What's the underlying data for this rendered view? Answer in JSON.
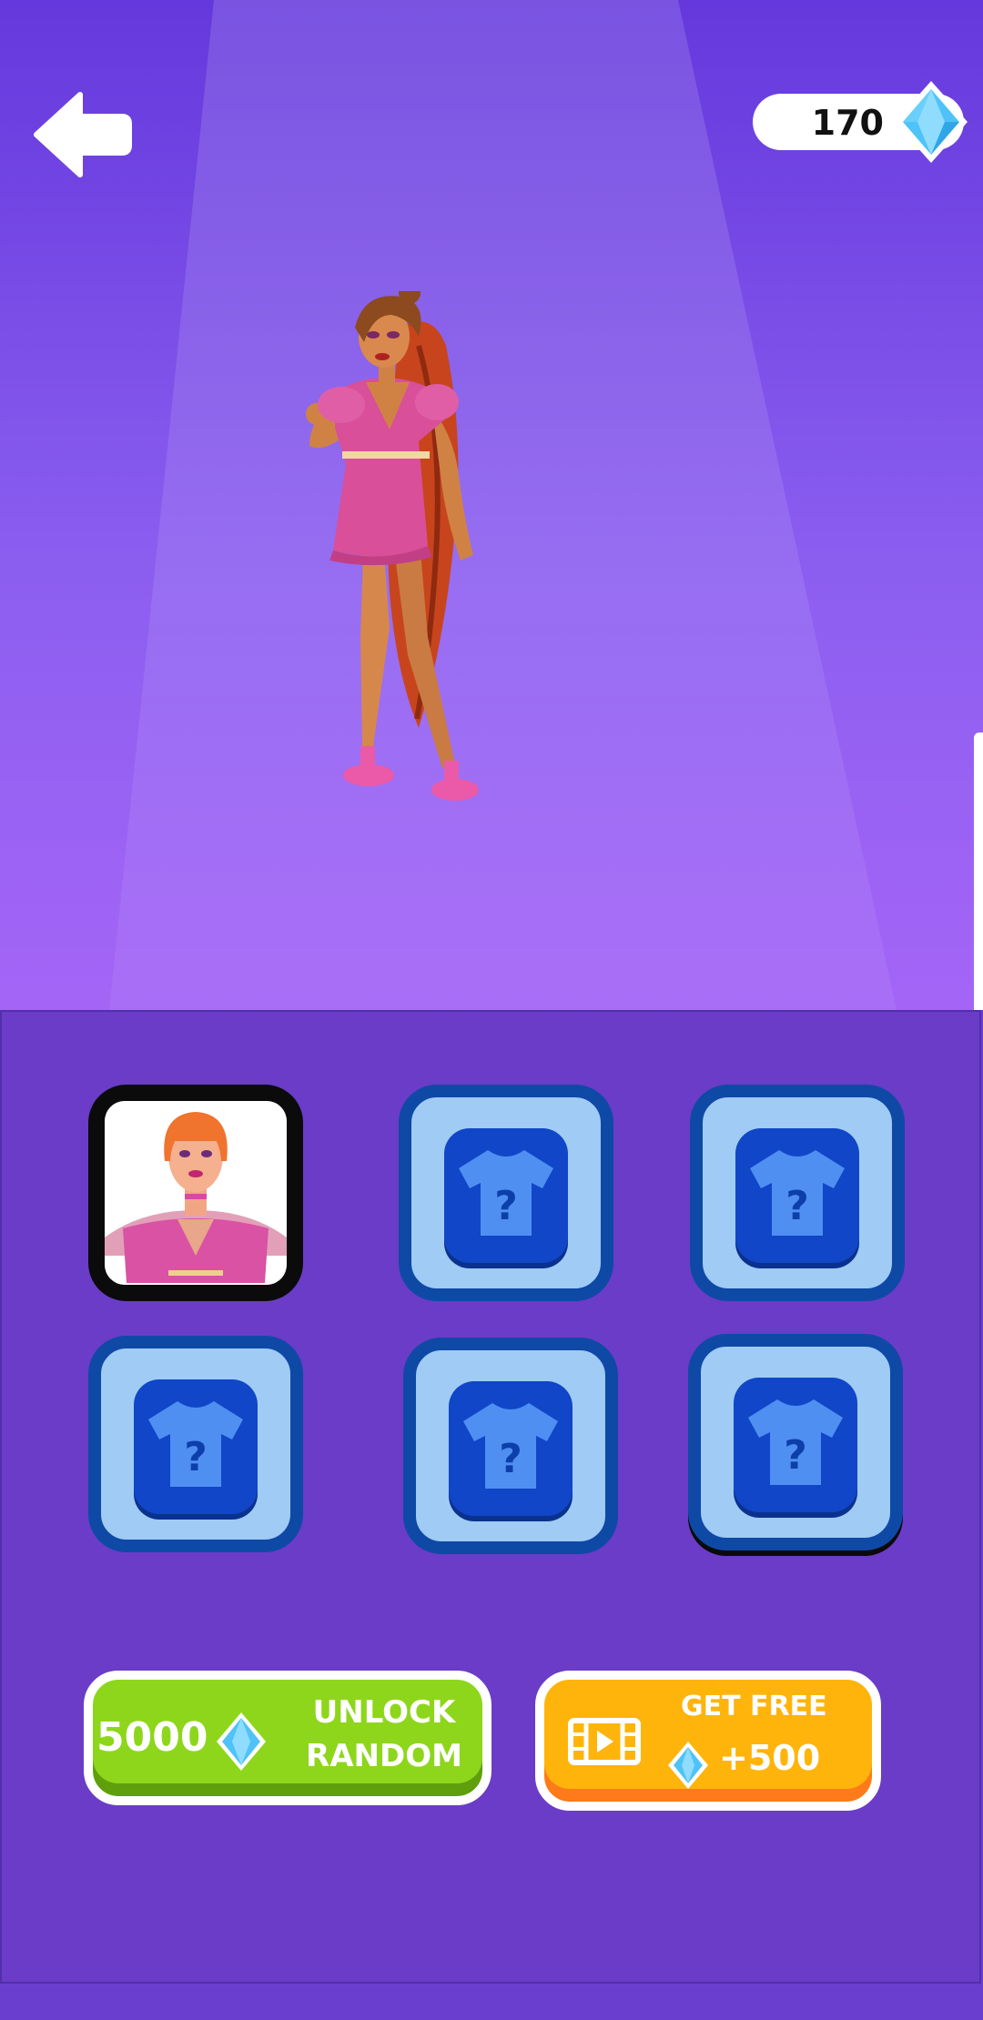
{
  "currency": {
    "amount": "170"
  },
  "shop": {
    "slots": [
      {
        "state": "selected",
        "label": ""
      },
      {
        "state": "locked",
        "label": "?"
      },
      {
        "state": "locked",
        "label": "?"
      },
      {
        "state": "locked",
        "label": "?"
      },
      {
        "state": "locked",
        "label": "?"
      },
      {
        "state": "locked",
        "label": "?"
      }
    ]
  },
  "buttons": {
    "unlock_random": {
      "cost": "5000",
      "line1": "UNLOCK",
      "line2": "RANDOM"
    },
    "get_free": {
      "line1": "GET FREE",
      "amount": "+500"
    }
  },
  "colors": {
    "accent_green": "#8ed61b",
    "accent_orange": "#ffb40b",
    "locked_slot_border": "#0f49a6",
    "gem_blue": "#4fc3f7"
  },
  "icons": [
    "back-arrow-icon",
    "gem-icon",
    "mystery-shirt-icon",
    "video-film-icon"
  ]
}
